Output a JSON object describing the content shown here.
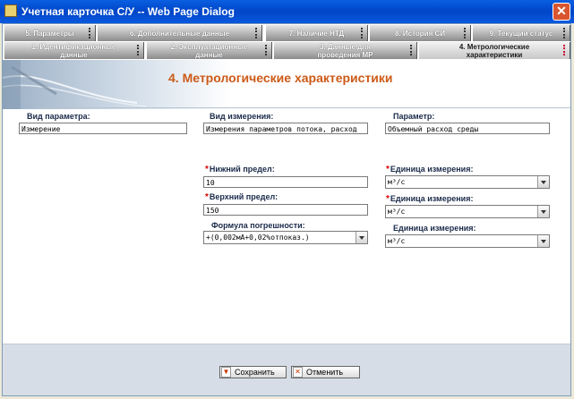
{
  "window": {
    "title": "Учетная карточка С/У -- Web Page Dialog",
    "close_glyph": "✕"
  },
  "tabs_row1": [
    {
      "label": "5. Параметры"
    },
    {
      "label": "6. Дополнительные данные"
    },
    {
      "label": "7. Наличие НТД"
    },
    {
      "label": "8. История СИ"
    },
    {
      "label": "9. Текущий статус"
    }
  ],
  "tabs_row2": [
    {
      "label": "1. Идентификационные данные"
    },
    {
      "label": "2. Эксплуатационные данные"
    },
    {
      "label": "3. Данные для проведения МР"
    },
    {
      "label": "4. Метрологические характеристики",
      "active": true
    }
  ],
  "heading": "4. Метрологические характеристики",
  "form": {
    "param_kind_label": "Вид параметра:",
    "param_kind_value": "Измерение",
    "measure_kind_label": "Вид измерения:",
    "measure_kind_value": "Измерения параметров потока, расход",
    "param_label": "Параметр:",
    "param_value": "Объемный расход среды",
    "low_label": "Нижний предел:",
    "low_value": "10",
    "high_label": "Верхний предел:",
    "high_value": "150",
    "formula_label": "Формула погрешности:",
    "formula_value": "+(0,002мА+0,02%отпоказ.)",
    "unit1_label": "Единица измерения:",
    "unit1_value": "м³/с",
    "unit2_label": "Единица измерения:",
    "unit2_value": "м³/с",
    "unit3_label": "Единица измерения:",
    "unit3_value": "м³/с",
    "required_mark": "*"
  },
  "buttons": {
    "save": "Сохранить",
    "cancel": "Отменить"
  },
  "colors": {
    "heading": "#cc5a18",
    "titlebar": "#0045c8",
    "required": "#dd0000"
  }
}
